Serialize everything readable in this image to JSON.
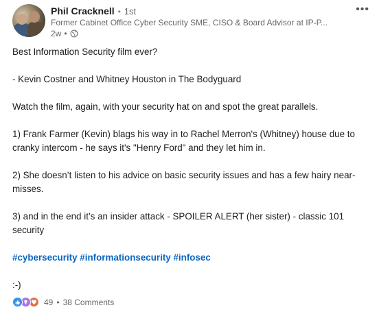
{
  "post": {
    "author": {
      "name": "Phil Cracknell",
      "degree": "1st",
      "headline": "Former Cabinet Office Cyber Security SME, CISO & Board Advisor at IP-P...",
      "time": "2w"
    },
    "separator": "•",
    "more_label": "•••",
    "body": {
      "line1": "Best Information Security film ever?",
      "line2": "- Kevin Costner and Whitney Houston in The Bodyguard",
      "line3": "Watch the film, again, with your security hat on and spot the great parallels.",
      "point1": "1) Frank Farmer (Kevin) blags his way in to Rachel Merron's (Whitney) house due to cranky intercom - he says it's \"Henry Ford\" and they let him in.",
      "point2": "2) She doesn’t listen to his advice on basic security issues and has a few hairy near-misses.",
      "point3": "3) and in the end it’s an insider attack - SPOILER ALERT (her sister) - classic 101 security",
      "hashtags": [
        "#cybersecurity",
        "#informationsecurity",
        "#infosec"
      ],
      "closing": ":-)"
    },
    "social": {
      "reactions": [
        "like-icon",
        "insightful-icon",
        "love-icon"
      ],
      "reaction_count": "49",
      "comments": "38 Comments"
    }
  }
}
